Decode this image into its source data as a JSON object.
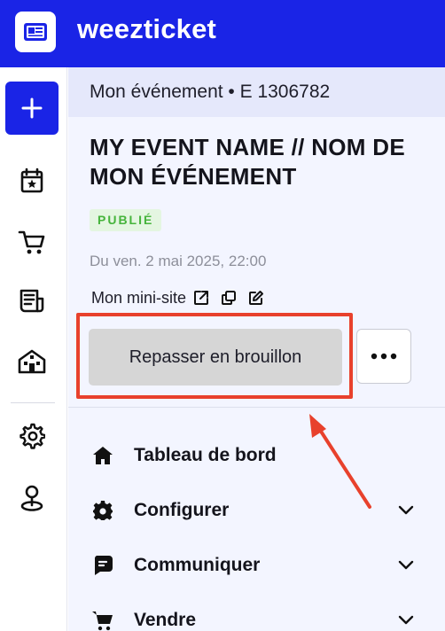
{
  "brand": {
    "name": "weezticket"
  },
  "colors": {
    "primary": "#1a24e6",
    "status_published": "#46b43c",
    "highlight": "#e8412c"
  },
  "rail": {
    "items": [
      {
        "icon": "plus-icon",
        "label": "Créer"
      },
      {
        "icon": "calendar-star-icon"
      },
      {
        "icon": "cart-icon"
      },
      {
        "icon": "newspaper-icon"
      },
      {
        "icon": "building-icon"
      },
      {
        "icon": "gear-icon"
      },
      {
        "icon": "location-pin-icon"
      }
    ]
  },
  "header": {
    "breadcrumb": "Mon événement • E 1306782"
  },
  "event": {
    "title": "MY EVENT NAME // NOM DE MON ÉVÉNEMENT",
    "status": "PUBLIÉ",
    "date": "Du ven. 2 mai 2025, 22:00",
    "minisite_label": "Mon mini-site"
  },
  "actions": {
    "draft_button": "Repasser en brouillon",
    "more_button": "•••"
  },
  "nav": {
    "items": [
      {
        "label": "Tableau de bord",
        "icon": "home-icon",
        "expandable": false
      },
      {
        "label": "Configurer",
        "icon": "gear-icon",
        "expandable": true
      },
      {
        "label": "Communiquer",
        "icon": "message-icon",
        "expandable": true
      },
      {
        "label": "Vendre",
        "icon": "cart-icon",
        "expandable": true
      }
    ]
  }
}
